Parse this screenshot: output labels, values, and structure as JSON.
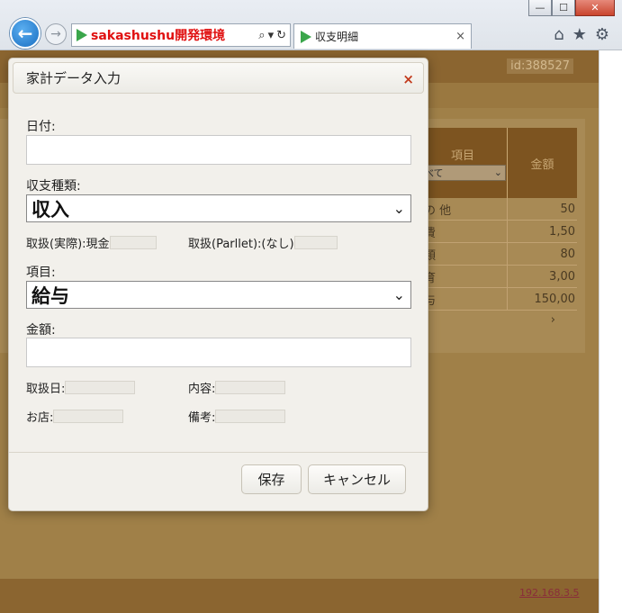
{
  "browser": {
    "address": "sakashushu開発環境",
    "tab_title": "収支明細",
    "close_glyph": "×",
    "window_buttons": [
      "—",
      "☐",
      "✕"
    ],
    "toolbar_icons": [
      "home-icon",
      "star-icon",
      "gear-icon"
    ]
  },
  "background_page": {
    "id_label": "id:388527",
    "grid": {
      "headers": [
        "項目",
        "金額"
      ],
      "filter_value": "べて",
      "rows": [
        [
          "の 他",
          "50"
        ],
        [
          "費",
          "1,50"
        ],
        [
          "類",
          "80"
        ],
        [
          "育",
          "3,00"
        ],
        [
          "与",
          "150,00"
        ]
      ],
      "scroll_glyph": "›"
    },
    "footer_link": "192.168.3.5"
  },
  "dialog": {
    "title": "家計データ入力",
    "close_glyph": "×",
    "date_label": "日付:",
    "date_value": "",
    "type_label": "収支種類:",
    "type_value": "収入",
    "actual_label": "取扱(実際):現金",
    "actual_value": "",
    "parllet_label": "取扱(Parllet):(なし)",
    "parllet_value": "",
    "item_label": "項目:",
    "item_value": "給与",
    "amount_label": "金額:",
    "amount_value": "",
    "handled_date_label": "取扱日:",
    "handled_date_value": "",
    "content_label": "内容:",
    "content_value": "",
    "shop_label": "お店:",
    "shop_value": "",
    "note_label": "備考:",
    "note_value": "",
    "save_button": "保存",
    "cancel_button": "キャンセル"
  },
  "colors": {
    "overlay_brown": "#a08048",
    "header_brown": "#8b6530",
    "dialog_bg": "#f2f0eb",
    "close_red": "#c23a1c",
    "address_red": "#e01010"
  }
}
